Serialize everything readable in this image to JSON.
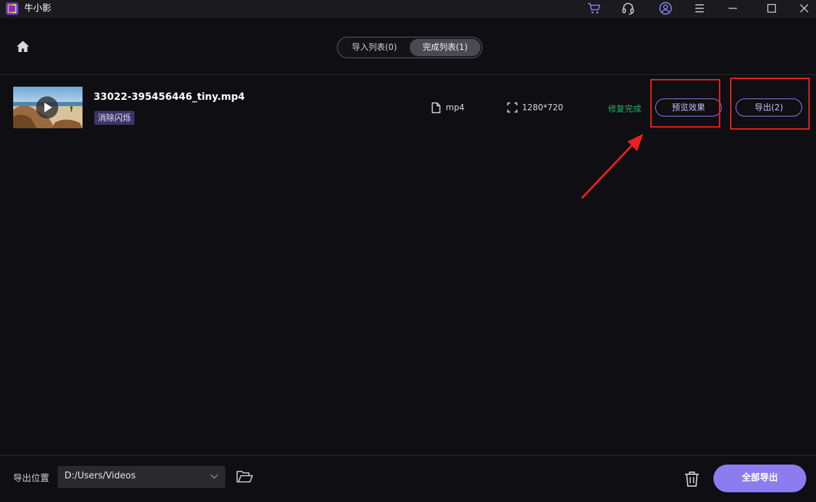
{
  "app": {
    "title": "牛小影",
    "accent_color": "#8c7cf0",
    "titlebar_icons": [
      "cart-icon",
      "headset-icon",
      "user-icon",
      "menu-icon",
      "minimize-icon",
      "maximize-icon",
      "close-icon"
    ]
  },
  "header": {
    "tabs": [
      {
        "label": "导入列表(0)",
        "selected": false
      },
      {
        "label": "完成列表(1)",
        "selected": true
      }
    ]
  },
  "items": [
    {
      "file_name": "33022-395456446_tiny.mp4",
      "tag": "消除闪烁",
      "format": "mp4",
      "resolution": "1280*720",
      "status": "修复完成",
      "status_color": "#22b46b",
      "preview_label": "预览效果",
      "export_label": "导出(2)"
    }
  ],
  "footer": {
    "path_label": "导出位置",
    "path_value": "D:/Users/Videos",
    "export_all_label": "全部导出"
  },
  "annotation": {
    "highlight_color": "#e8201e"
  }
}
